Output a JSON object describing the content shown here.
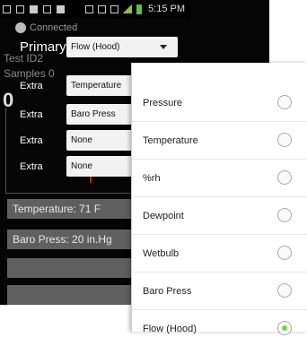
{
  "status_bar": {
    "time": "5:15 PM",
    "icons": [
      "notification-icon",
      "mail-icon",
      "upload-icon",
      "image-icon",
      "stop-icon",
      "bluetooth-icon",
      "vibrate-icon",
      "data-icon",
      "signal-icon",
      "battery-icon"
    ]
  },
  "app": {
    "connection_text": "Connected",
    "primary_label": "Primary",
    "primary_value": "Flow (Hood)",
    "test_id": "Test ID2",
    "samples": "Samples 0",
    "big_value": "0",
    "extras": [
      {
        "label": "Extra",
        "value": "Temperature"
      },
      {
        "label": "Extra",
        "value": "Baro Press"
      },
      {
        "label": "Extra",
        "value": "None"
      },
      {
        "label": "Extra",
        "value": "None"
      }
    ],
    "readings": [
      "Temperature: 71 F",
      "Baro Press: 20 in.Hg"
    ]
  },
  "popup": {
    "options": [
      {
        "label": "Pressure",
        "selected": false
      },
      {
        "label": "Temperature",
        "selected": false
      },
      {
        "label": "%rh",
        "selected": false
      },
      {
        "label": "Dewpoint",
        "selected": false
      },
      {
        "label": "Wetbulb",
        "selected": false
      },
      {
        "label": "Baro Press",
        "selected": false
      },
      {
        "label": "Flow (Hood)",
        "selected": true
      }
    ],
    "selected_color": "#76d14f"
  }
}
